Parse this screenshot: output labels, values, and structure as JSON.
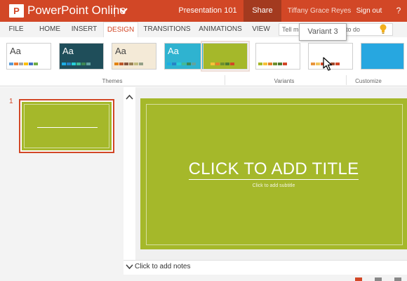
{
  "app": {
    "name": "PowerPoint Online",
    "logo_letter": "P",
    "document_title": "Presentation 101"
  },
  "header": {
    "share_label": "Share",
    "user_name": "Tiffany Grace Reyes",
    "sign_out_label": "Sign out",
    "help_label": "?"
  },
  "tabs": [
    {
      "label": "FILE"
    },
    {
      "label": "HOME"
    },
    {
      "label": "INSERT"
    },
    {
      "label": "DESIGN",
      "active": true
    },
    {
      "label": "TRANSITIONS"
    },
    {
      "label": "ANIMATIONS"
    },
    {
      "label": "VIEW"
    }
  ],
  "tell_me": {
    "placeholder": "Tell me what you want to do"
  },
  "ribbon": {
    "groups": {
      "themes_label": "Themes",
      "variants_label": "Variants",
      "customize_label": "Customize"
    },
    "themes": [
      {
        "name": "office-theme",
        "sample_text": "Aa",
        "background": "#ffffff",
        "text_color": "#444444",
        "swatches": [
          "#5b9bd5",
          "#ed7d31",
          "#a5a5a5",
          "#ffc000",
          "#4472c4",
          "#70ad47"
        ]
      },
      {
        "name": "dark-teal-theme",
        "sample_text": "Aa",
        "background": "#1f4e5a",
        "text_color": "#ffffff",
        "swatches": [
          "#1cade4",
          "#2683c6",
          "#27ced7",
          "#42ba97",
          "#3e8853",
          "#62a39f"
        ]
      },
      {
        "name": "paper-theme",
        "sample_text": "Aa",
        "background": "#f4ead7",
        "text_color": "#444444",
        "swatches": [
          "#e48312",
          "#bd582c",
          "#865640",
          "#9b8357",
          "#c2bc80",
          "#94a088"
        ]
      },
      {
        "name": "sky-blue-theme",
        "sample_text": "Aa",
        "background": "#2fb3d0",
        "text_color": "#ffffff",
        "swatches": [
          "#1cade4",
          "#2683c6",
          "#27ced7",
          "#42ba97",
          "#3e8853",
          "#62a39f"
        ]
      }
    ],
    "variants": [
      {
        "name": "variant-1",
        "background": "#a5b82a",
        "swatches": [
          "#a5b82a",
          "#f7c136",
          "#e57f2a",
          "#6e8f2f",
          "#4e7c33",
          "#d24726"
        ],
        "selected": true
      },
      {
        "name": "variant-2",
        "background": "#ffffff",
        "swatches": [
          "#a5b82a",
          "#f7c136",
          "#e57f2a",
          "#6e8f2f",
          "#4e7c33",
          "#d24726"
        ]
      },
      {
        "name": "variant-3",
        "background": "#ffffff",
        "swatches": [
          "#e8943a",
          "#f2c55c",
          "#d24726",
          "#7d8d3a",
          "#9d4a2e",
          "#d24726"
        ]
      },
      {
        "name": "variant-4",
        "background": "#27a7e0",
        "swatches": []
      }
    ],
    "tooltip": "Variant 3"
  },
  "slides_pane": {
    "slides": [
      {
        "number": "1"
      }
    ]
  },
  "slide": {
    "background": "#a5b82a",
    "title_placeholder": "CLICK TO ADD TITLE",
    "subtitle_placeholder": "Click to add subtitle"
  },
  "notes": {
    "placeholder": "Click to add notes"
  },
  "colors": {
    "accent": "#d24726",
    "share_bg": "#a33a1f",
    "slide_green": "#a5b82a"
  }
}
